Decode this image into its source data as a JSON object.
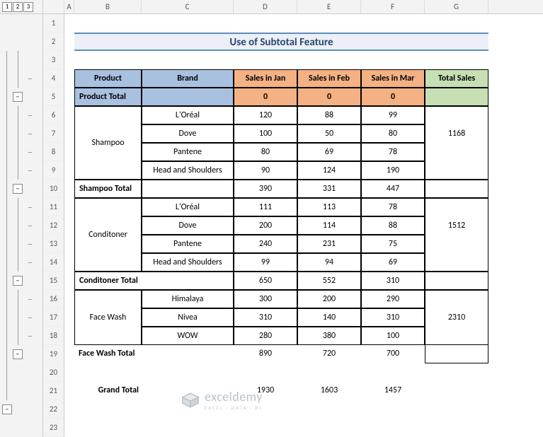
{
  "levels": [
    "1",
    "2",
    "3"
  ],
  "rowHeaders": [
    "1",
    "2",
    "3",
    "4",
    "5",
    "6",
    "7",
    "8",
    "9",
    "10",
    "11",
    "12",
    "13",
    "14",
    "15",
    "16",
    "17",
    "18",
    "19",
    "20",
    "21",
    "22",
    "23"
  ],
  "colHeaders": {
    "A": "A",
    "B": "B",
    "C": "C",
    "D": "D",
    "E": "E",
    "F": "F",
    "G": "G"
  },
  "title": "Use of Subtotal Feature",
  "head": {
    "product": "Product",
    "brand": "Brand",
    "jan": "Sales in Jan",
    "feb": "Sales in Feb",
    "mar": "Sales in Mar",
    "total": "Total Sales"
  },
  "ptotal": {
    "label": "Product Total",
    "jan": "0",
    "feb": "0",
    "mar": "0"
  },
  "shampoo": {
    "name": "Shampoo",
    "rows": [
      {
        "brand": "L'Oréal",
        "jan": "120",
        "feb": "88",
        "mar": "99"
      },
      {
        "brand": "Dove",
        "jan": "100",
        "feb": "50",
        "mar": "80"
      },
      {
        "brand": "Pantene",
        "jan": "80",
        "feb": "69",
        "mar": "78"
      },
      {
        "brand": "Head and Shoulders",
        "jan": "90",
        "feb": "124",
        "mar": "190"
      }
    ],
    "total": "1168",
    "sub": {
      "label": "Shampoo Total",
      "jan": "390",
      "feb": "331",
      "mar": "447"
    }
  },
  "conditioner": {
    "name": "Conditoner",
    "rows": [
      {
        "brand": "L'Oréal",
        "jan": "111",
        "feb": "113",
        "mar": "78"
      },
      {
        "brand": "Dove",
        "jan": "200",
        "feb": "114",
        "mar": "88"
      },
      {
        "brand": "Pantene",
        "jan": "240",
        "feb": "231",
        "mar": "75"
      },
      {
        "brand": "Head and Shoulders",
        "jan": "99",
        "feb": "94",
        "mar": "69"
      }
    ],
    "total": "1512",
    "sub": {
      "label": "Conditoner Total",
      "jan": "650",
      "feb": "552",
      "mar": "310"
    }
  },
  "facewash": {
    "name": "Face Wash",
    "rows": [
      {
        "brand": "Himalaya",
        "jan": "300",
        "feb": "200",
        "mar": "290"
      },
      {
        "brand": "Nivea",
        "jan": "310",
        "feb": "140",
        "mar": "310"
      },
      {
        "brand": "WOW",
        "jan": "280",
        "feb": "380",
        "mar": "100"
      }
    ],
    "total": "2310",
    "sub": {
      "label": "Face Wash Total",
      "jan": "890",
      "feb": "720",
      "mar": "700"
    }
  },
  "grand": {
    "label": "Grand Total",
    "jan": "1930",
    "feb": "1603",
    "mar": "1457"
  },
  "logo": {
    "name": "exceldemy",
    "tag": "EXCEL · DATA · BI"
  },
  "minus": "−"
}
